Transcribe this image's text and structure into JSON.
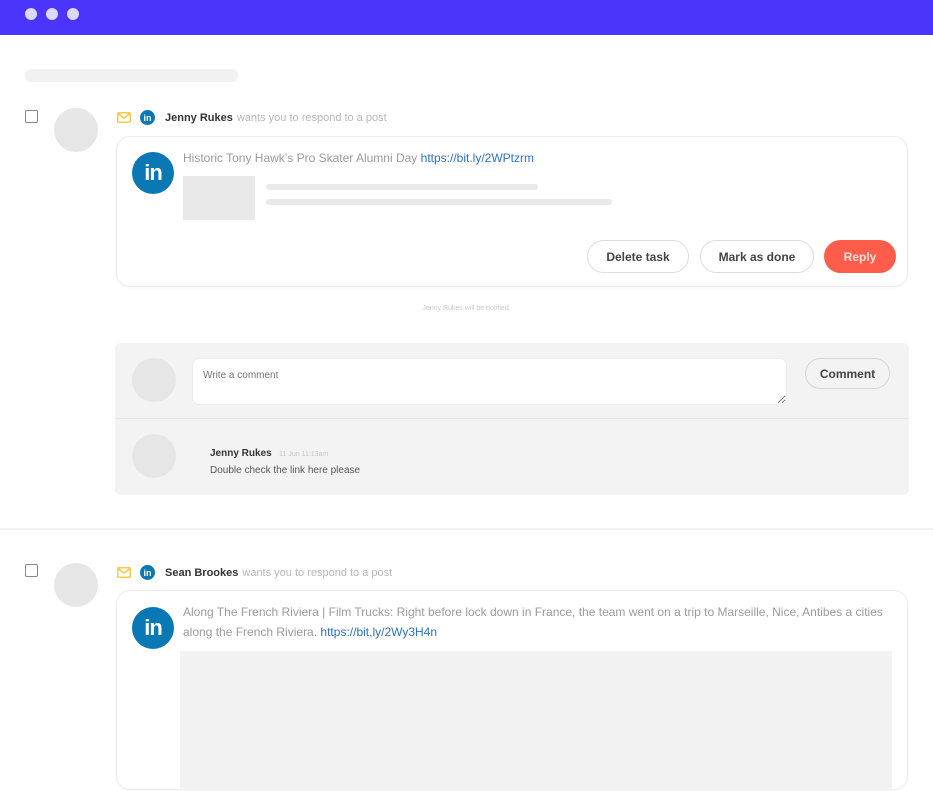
{
  "window": {
    "title_bar_color": "#4c35fb",
    "controls": [
      "dot",
      "dot",
      "dot"
    ]
  },
  "tasks": [
    {
      "author": "Jenny Rukes",
      "action": "wants you to respond to a post",
      "channel_icon": "linkedin-icon",
      "type_icon": "mail-icon",
      "post": {
        "text": "Historic Tony Hawk’s Pro Skater Alumni Day",
        "link": "https://bit.ly/2WPtzrm"
      },
      "buttons": {
        "delete": "Delete task",
        "done": "Mark as done",
        "reply": "Reply"
      },
      "notify_text": "Jenny Rukes will be notified.",
      "comments": {
        "input_placeholder": "Write a comment",
        "submit_label": "Comment",
        "items": [
          {
            "author": "Jenny Rukes",
            "time": "11 Jun 11:13am",
            "body": "Double check the link here please"
          }
        ]
      }
    },
    {
      "author": "Sean Brookes",
      "action": "wants you to respond to a post",
      "channel_icon": "linkedin-icon",
      "type_icon": "mail-icon",
      "post": {
        "text": "Along The French Riviera | Film Trucks: Right before lock down in France, the team went on a trip to Marseille, Nice, Antibes a cities along the French Riviera.",
        "link": "https://bit,ly/2Wy3H4n"
      }
    }
  ],
  "icons": {
    "linkedin_glyph": "in"
  },
  "colors": {
    "accent": "#4c35fb",
    "reply": "#ff5d4c",
    "linkedin": "#0a78b5",
    "link": "#2a72c7",
    "mail": "#f7c948"
  }
}
